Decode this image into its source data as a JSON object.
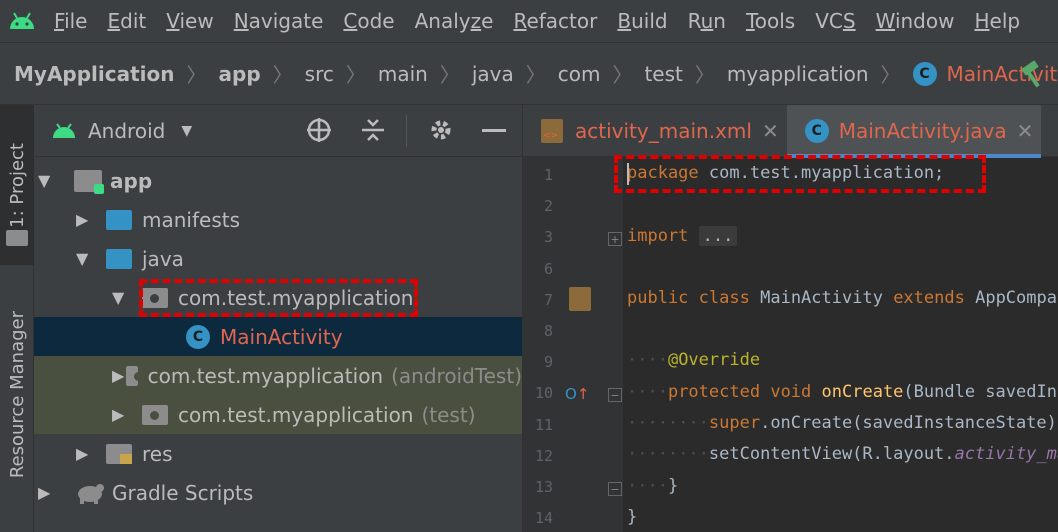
{
  "menubar": {
    "items": [
      {
        "pre": "",
        "mn": "F",
        "post": "ile"
      },
      {
        "pre": "",
        "mn": "E",
        "post": "dit"
      },
      {
        "pre": "",
        "mn": "V",
        "post": "iew"
      },
      {
        "pre": "",
        "mn": "N",
        "post": "avigate"
      },
      {
        "pre": "",
        "mn": "C",
        "post": "ode"
      },
      {
        "pre": "Analy",
        "mn": "z",
        "post": "e"
      },
      {
        "pre": "",
        "mn": "R",
        "post": "efactor"
      },
      {
        "pre": "",
        "mn": "B",
        "post": "uild"
      },
      {
        "pre": "R",
        "mn": "u",
        "post": "n"
      },
      {
        "pre": "",
        "mn": "T",
        "post": "ools"
      },
      {
        "pre": "VC",
        "mn": "S",
        "post": ""
      },
      {
        "pre": "",
        "mn": "W",
        "post": "indow"
      },
      {
        "pre": "",
        "mn": "H",
        "post": "elp"
      }
    ]
  },
  "breadcrumb": {
    "items": [
      "MyApplication",
      "app",
      "src",
      "main",
      "java",
      "com",
      "test",
      "myapplication"
    ],
    "current": "MainActivity",
    "current_icon_letter": "C"
  },
  "left_strip": {
    "project_tab": "1: Project",
    "resource_tab": "Resource Manager"
  },
  "project_panel": {
    "view_selector": "Android",
    "tree": {
      "app": "app",
      "manifests": "manifests",
      "java": "java",
      "pkg_main": "com.test.myapplication",
      "main_activity": "MainActivity",
      "pkg_android_test": "com.test.myapplication",
      "pkg_android_test_suffix": "(androidTest)",
      "pkg_test": "com.test.myapplication",
      "pkg_test_suffix": "(test)",
      "res": "res",
      "gradle": "Gradle Scripts"
    }
  },
  "editor": {
    "tabs": [
      {
        "label": "activity_main.xml",
        "close": "✕"
      },
      {
        "label": "MainActivity.java",
        "close": "✕"
      }
    ],
    "line_numbers": [
      "1",
      "2",
      "3",
      "6",
      "7",
      "8",
      "9",
      "10",
      "11",
      "12",
      "13",
      "14"
    ],
    "code": {
      "l1_kw": "package",
      "l1_rest": " com.test.myapplication;",
      "l3_kw": "import",
      "l3_ellipsis": "...",
      "l7_kw1": "public",
      "l7_kw2": "class",
      "l7_name": "MainActivity",
      "l7_kw3": "extends",
      "l7_parent": "AppCompatActivity {",
      "l9_ann": "@Override",
      "l10_kw1": "protected",
      "l10_kw2": "void",
      "l10_fn": "onCreate",
      "l10_rest": "(Bundle savedInstanceState) {",
      "l11_kw": "super",
      "l11_rest": ".onCreate(savedInstanceState);",
      "l12_fn": "setContentView(R.layout.",
      "l12_it": "activity_main",
      "l12_end": ");",
      "l13": "}",
      "l14": "}"
    }
  },
  "colors": {
    "accent_red": "#e0664d",
    "class_icon": "#3592c4",
    "highlight_box": "#e00000"
  }
}
